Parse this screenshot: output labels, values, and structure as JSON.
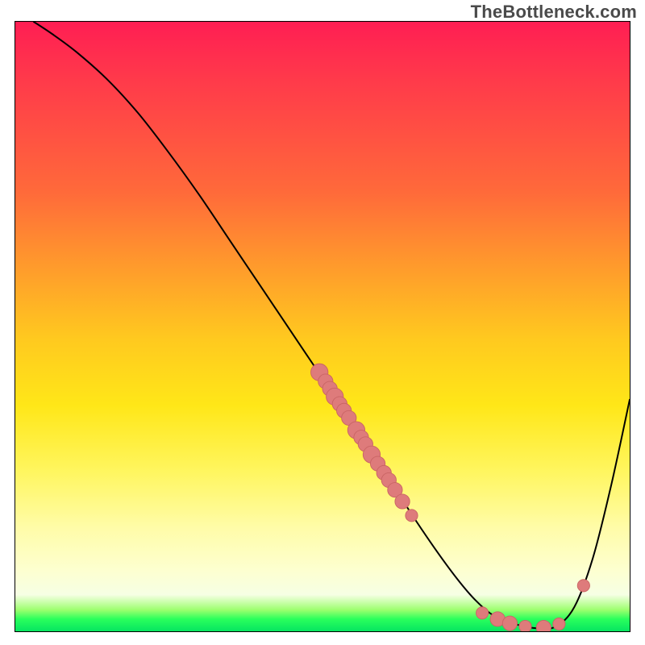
{
  "watermark": "TheBottleneck.com",
  "chart_data": {
    "type": "line",
    "title": "",
    "xlabel": "",
    "ylabel": "",
    "xlim": [
      0,
      100
    ],
    "ylim": [
      0,
      100
    ],
    "grid": false,
    "legend": false,
    "series": [
      {
        "name": "curve",
        "x": [
          3,
          6,
          10,
          15,
          20,
          25,
          30,
          35,
          40,
          45,
          50,
          55,
          60,
          64,
          68,
          72,
          75,
          78,
          82,
          85,
          88,
          91,
          94,
          97,
          100
        ],
        "y": [
          100,
          98,
          95,
          90.5,
          85,
          78.5,
          71.5,
          64,
          56.5,
          49,
          41.5,
          34,
          26.5,
          20,
          14,
          8.5,
          5,
          2.5,
          1,
          0.5,
          0.8,
          4,
          12,
          24,
          38
        ]
      }
    ],
    "markers": [
      {
        "x": 49.5,
        "y": 42.5,
        "r": 1.4
      },
      {
        "x": 50.5,
        "y": 41,
        "r": 1.2
      },
      {
        "x": 51.2,
        "y": 39.8,
        "r": 1.2
      },
      {
        "x": 52.0,
        "y": 38.5,
        "r": 1.4
      },
      {
        "x": 52.8,
        "y": 37.3,
        "r": 1.2
      },
      {
        "x": 53.5,
        "y": 36.2,
        "r": 1.2
      },
      {
        "x": 54.3,
        "y": 35,
        "r": 1.2
      },
      {
        "x": 55.5,
        "y": 33,
        "r": 1.4
      },
      {
        "x": 56.3,
        "y": 31.8,
        "r": 1.2
      },
      {
        "x": 57.0,
        "y": 30.7,
        "r": 1.2
      },
      {
        "x": 58.0,
        "y": 29,
        "r": 1.4
      },
      {
        "x": 59.0,
        "y": 27.5,
        "r": 1.2
      },
      {
        "x": 60.0,
        "y": 26,
        "r": 1.2
      },
      {
        "x": 60.8,
        "y": 24.8,
        "r": 1.2
      },
      {
        "x": 61.8,
        "y": 23.2,
        "r": 1.2
      },
      {
        "x": 63.0,
        "y": 21.3,
        "r": 1.2
      },
      {
        "x": 64.5,
        "y": 19,
        "r": 1.0
      },
      {
        "x": 76.0,
        "y": 3.0,
        "r": 1.0
      },
      {
        "x": 78.5,
        "y": 2.0,
        "r": 1.2
      },
      {
        "x": 80.5,
        "y": 1.3,
        "r": 1.2
      },
      {
        "x": 83.0,
        "y": 0.8,
        "r": 1.0
      },
      {
        "x": 86.0,
        "y": 0.6,
        "r": 1.2
      },
      {
        "x": 88.5,
        "y": 1.2,
        "r": 1.0
      },
      {
        "x": 92.5,
        "y": 7.5,
        "r": 1.0
      }
    ],
    "colors": {
      "curve": "#000000",
      "marker_fill": "#de7b7b",
      "marker_stroke": "#c96464"
    }
  }
}
